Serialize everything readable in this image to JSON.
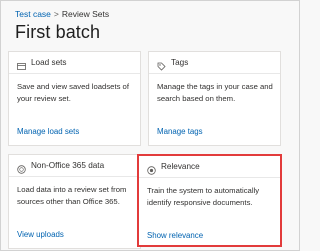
{
  "breadcrumb": {
    "items": [
      "Test case",
      "Review Sets"
    ],
    "separator": ">"
  },
  "page": {
    "title": "First batch"
  },
  "cards": [
    {
      "title": "Load sets",
      "icon": "load-sets-icon",
      "description": "Save and view saved loadsets of your review set.",
      "link": "Manage load sets"
    },
    {
      "title": "Tags",
      "icon": "tag-icon",
      "description": "Manage the tags in your case and search based on them.",
      "link": "Manage tags"
    },
    {
      "title": "Non-Office 365 data",
      "icon": "globe-icon",
      "description": "Load data into a review set from sources other than Office 365.",
      "link": "View uploads"
    },
    {
      "title": "Relevance",
      "icon": "relevance-icon",
      "description": "Train the system to automatically identify responsive documents.",
      "link": "Show relevance"
    }
  ],
  "colors": {
    "link": "#0063b1",
    "highlight": "#e23b3b",
    "card_border": "#e1dfdd",
    "background": "#f8f8f8"
  }
}
